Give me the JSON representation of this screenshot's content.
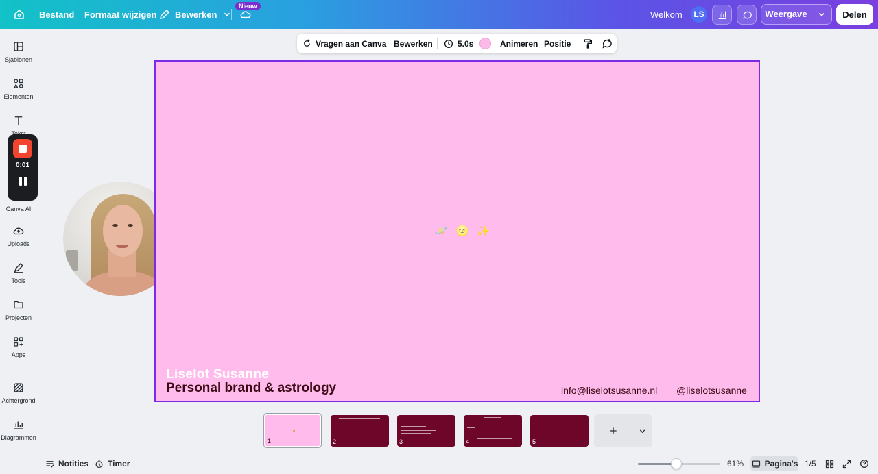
{
  "topbar": {
    "file": "Bestand",
    "resize": "Formaat wijzigen",
    "edit": "Bewerken",
    "new_badge": "Nieuw",
    "welcome": "Welkom",
    "avatar_initials": "LS",
    "view": "Weergave",
    "share": "Delen"
  },
  "sidebar": {
    "items": [
      {
        "label": "Sjablonen",
        "icon": "templates-icon"
      },
      {
        "label": "Elementen",
        "icon": "elements-icon"
      },
      {
        "label": "Tekst",
        "icon": "text-icon"
      },
      {
        "label": "Canva AI",
        "icon": "canva-ai-icon"
      },
      {
        "label": "Uploads",
        "icon": "upload-cloud-icon"
      },
      {
        "label": "Tools",
        "icon": "pen-icon"
      },
      {
        "label": "Projecten",
        "icon": "folder-icon"
      },
      {
        "label": "Apps",
        "icon": "apps-icon"
      },
      {
        "label": "Achtergrond",
        "icon": "background-icon"
      },
      {
        "label": "Diagrammen",
        "icon": "chart-icon"
      }
    ]
  },
  "recorder": {
    "time": "0:01",
    "progress_fraction": 0
  },
  "floating_toolbar": {
    "ask_canva": "Vragen aan Canva",
    "edit": "Bewerken",
    "duration": "5.0s",
    "swatch_color": "#fdb9ea",
    "animate": "Animeren",
    "position": "Positie"
  },
  "canvas": {
    "background_color": "#ffbbec",
    "emojis": "🪐 🌝 ✨",
    "name": "Liselot Susanne",
    "tagline": "Personal brand & astrology",
    "email": "info@liselotsusanne.nl",
    "handle": "@liselotsusanne"
  },
  "pages": [
    {
      "number": "1",
      "active": true
    },
    {
      "number": "2",
      "active": false
    },
    {
      "number": "3",
      "active": false
    },
    {
      "number": "4",
      "active": false
    },
    {
      "number": "5",
      "active": false
    }
  ],
  "bottombar": {
    "notes": "Notities",
    "timer": "Timer",
    "zoom": "61%",
    "zoom_fraction": 0.46,
    "pages_label": "Pagina's",
    "page_count": "1/5"
  },
  "colors": {
    "accent": "#7d2ae8",
    "thumb_dark": "#6e0629",
    "record_red": "#f2452f"
  }
}
